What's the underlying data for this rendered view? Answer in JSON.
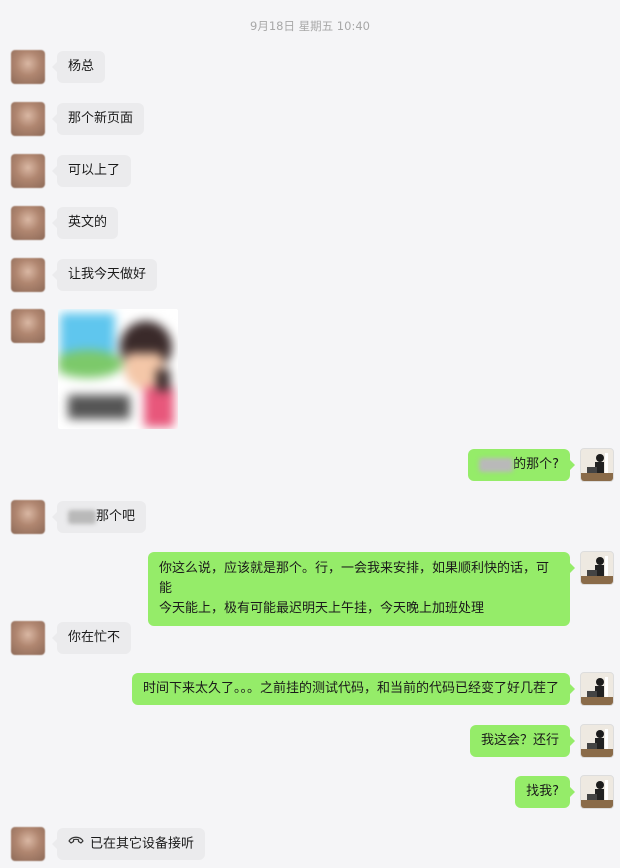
{
  "timestamp": "9月18日 星期五 10:40",
  "messages": {
    "m1": "杨总",
    "m2": "那个新页面",
    "m3": "可以上了",
    "m4": "英文的",
    "m5": "让我今天做好",
    "m7_suffix": "的那个?",
    "m8_suffix": "那个吧",
    "m9_line1": "你这么说，应该就是那个。行，一会我来安排，如果顺利快的话，可能",
    "m9_line2": "今天能上，极有可能最迟明天上午挂，今天晚上加班处理",
    "m10": "你在忙不",
    "m11": "时间下来太久了。。。之前挂的测试代码，和当前的代码已经变了好几茬了",
    "m12": "我这会？还行",
    "m13": "找我?",
    "m14": "已在其它设备接听"
  },
  "colors": {
    "outgoing_bubble": "#95ec69",
    "incoming_bubble": "#ebebed",
    "background": "#f5f5f7"
  }
}
